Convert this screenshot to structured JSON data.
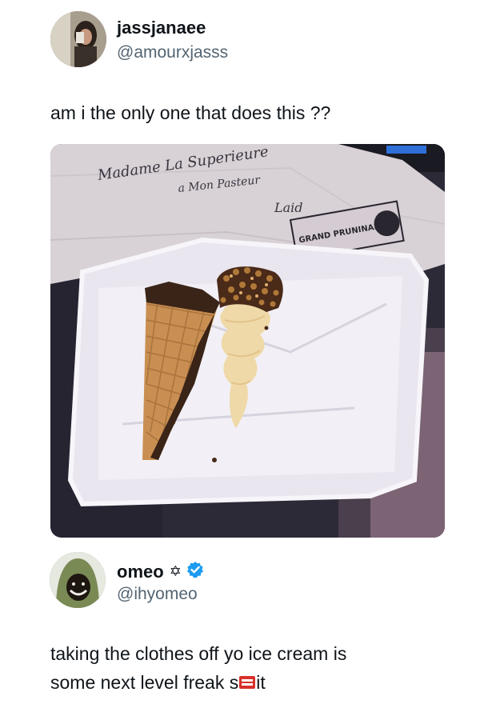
{
  "post": {
    "author_name": "jassjanaee",
    "author_handle": "@amourxjasss",
    "text": "am i the only one that does this ??"
  },
  "reply": {
    "author_name": "omeo",
    "author_badge_glyph": "✡",
    "author_handle": "@ihyomeo",
    "verified": true,
    "text_line1": "taking the clothes off yo ice cream is",
    "text_line2_prefix": "some next level freak s",
    "text_line2_suffix": "it"
  },
  "media": {
    "icon": "ice-cream-photo",
    "paper_handwriting": "Madame La Superieure",
    "wrapper_stamp": "GRAND PRUNINAIRE"
  },
  "colors": {
    "verified_blue": "#1d9bf0",
    "name_text": "#0f1419",
    "handle_text": "#536471"
  }
}
